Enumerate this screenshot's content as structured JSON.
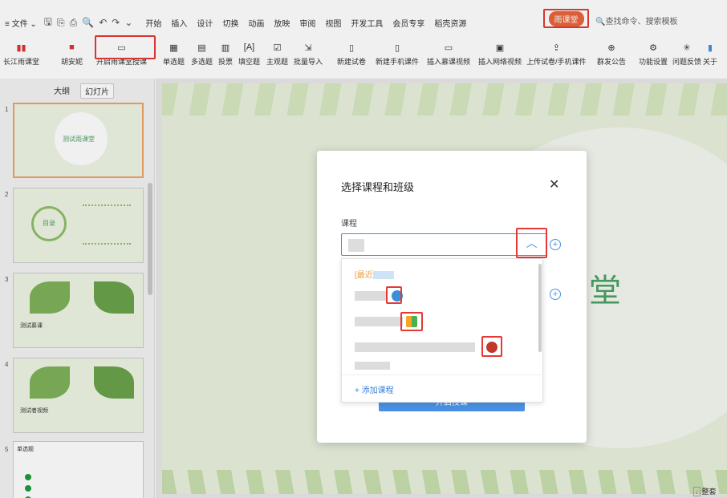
{
  "menu": {
    "file": "文件",
    "tabs": [
      "开始",
      "插入",
      "设计",
      "切换",
      "动画",
      "放映",
      "审阅",
      "视图",
      "开发工具",
      "会员专享",
      "稻壳资源"
    ],
    "active_tab": "雨课堂",
    "search_placeholder": "查找命令、搜索模板"
  },
  "ribbon": {
    "buttons": [
      "长江雨课堂",
      "胡安妮",
      "开启雨课堂授课",
      "单选题",
      "多选题",
      "投票",
      "填空题",
      "主观题",
      "批量导入",
      "新建试卷",
      "新建手机课件",
      "插入慕课视频",
      "插入网络视频",
      "上传试卷/手机课件",
      "群发公告",
      "功能设置",
      "问题反馈",
      "关于"
    ]
  },
  "sidebar": {
    "tabs": [
      "大纲",
      "幻灯片"
    ],
    "slides": [
      {
        "num": "1",
        "title": "测试雨课堂"
      },
      {
        "num": "2",
        "title": "目录"
      },
      {
        "num": "3",
        "title": "测试慕课"
      },
      {
        "num": "4",
        "title": "测试者视频"
      },
      {
        "num": "5",
        "title": "单选题"
      }
    ]
  },
  "slide": {
    "visible_char": "堂"
  },
  "modal": {
    "title": "选择课程和班级",
    "course_label": "课程",
    "recent_label": "[最近",
    "add_course": "+ 添加课程",
    "start_button": "开启授课"
  },
  "footer": {
    "bottom_right": "整套"
  },
  "colors": {
    "accent": "#4a90e2",
    "highlight": "#e53935",
    "rain_tab": "#e8643a"
  }
}
